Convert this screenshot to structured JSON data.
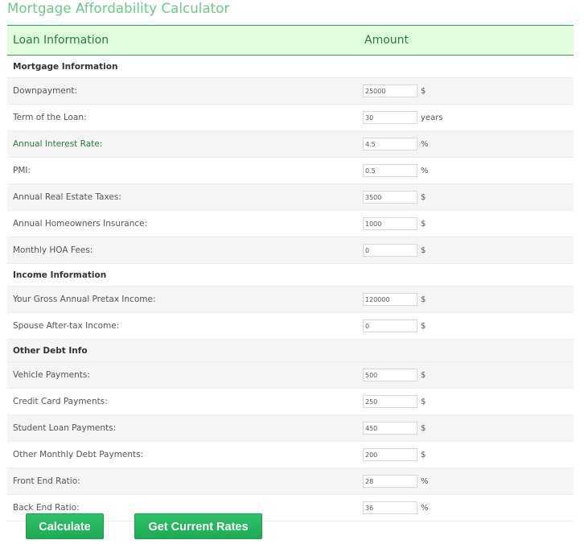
{
  "page": {
    "title": "Mortgage Affordability Calculator"
  },
  "table": {
    "headers": {
      "label": "Loan Information",
      "amount": "Amount"
    },
    "sections": [
      {
        "title": "Mortgage Information",
        "rows": [
          {
            "label": "Downpayment:",
            "value": "25000",
            "unit": "$",
            "highlight": false
          },
          {
            "label": "Term of the Loan:",
            "value": "30",
            "unit": "years",
            "highlight": false
          },
          {
            "label": "Annual Interest Rate:",
            "value": "4.5",
            "unit": "%",
            "highlight": true
          },
          {
            "label": "PMI:",
            "value": "0.5",
            "unit": "%",
            "highlight": false
          },
          {
            "label": "Annual Real Estate Taxes:",
            "value": "3500",
            "unit": "$",
            "highlight": false
          },
          {
            "label": "Annual Homeowners Insurance:",
            "value": "1000",
            "unit": "$",
            "highlight": false
          },
          {
            "label": "Monthly HOA Fees:",
            "value": "0",
            "unit": "$",
            "highlight": false
          }
        ]
      },
      {
        "title": "Income Information",
        "rows": [
          {
            "label": "Your Gross Annual Pretax Income:",
            "value": "120000",
            "unit": "$",
            "highlight": false
          },
          {
            "label": "Spouse After-tax Income:",
            "value": "0",
            "unit": "$",
            "highlight": false
          }
        ]
      },
      {
        "title": "Other Debt Info",
        "rows": [
          {
            "label": "Vehicle Payments:",
            "value": "500",
            "unit": "$",
            "highlight": false
          },
          {
            "label": "Credit Card Payments:",
            "value": "250",
            "unit": "$",
            "highlight": false
          },
          {
            "label": "Student Loan Payments:",
            "value": "450",
            "unit": "$",
            "highlight": false
          },
          {
            "label": "Other Monthly Debt Payments:",
            "value": "200",
            "unit": "$",
            "highlight": false
          },
          {
            "label": "Front End Ratio:",
            "value": "28",
            "unit": "%",
            "highlight": false
          },
          {
            "label": "Back End Ratio:",
            "value": "36",
            "unit": "%",
            "highlight": false
          }
        ]
      }
    ]
  },
  "buttons": {
    "calculate_label": "Calculate",
    "rates_label": "Get Current Rates"
  },
  "colors": {
    "title_green": "#6cc987",
    "header_bg": "#e2fdde",
    "header_border": "#2f9e60",
    "header_text": "#2b7a46",
    "button_green": "#22b35d",
    "row_shade": "#f5f5f5"
  }
}
